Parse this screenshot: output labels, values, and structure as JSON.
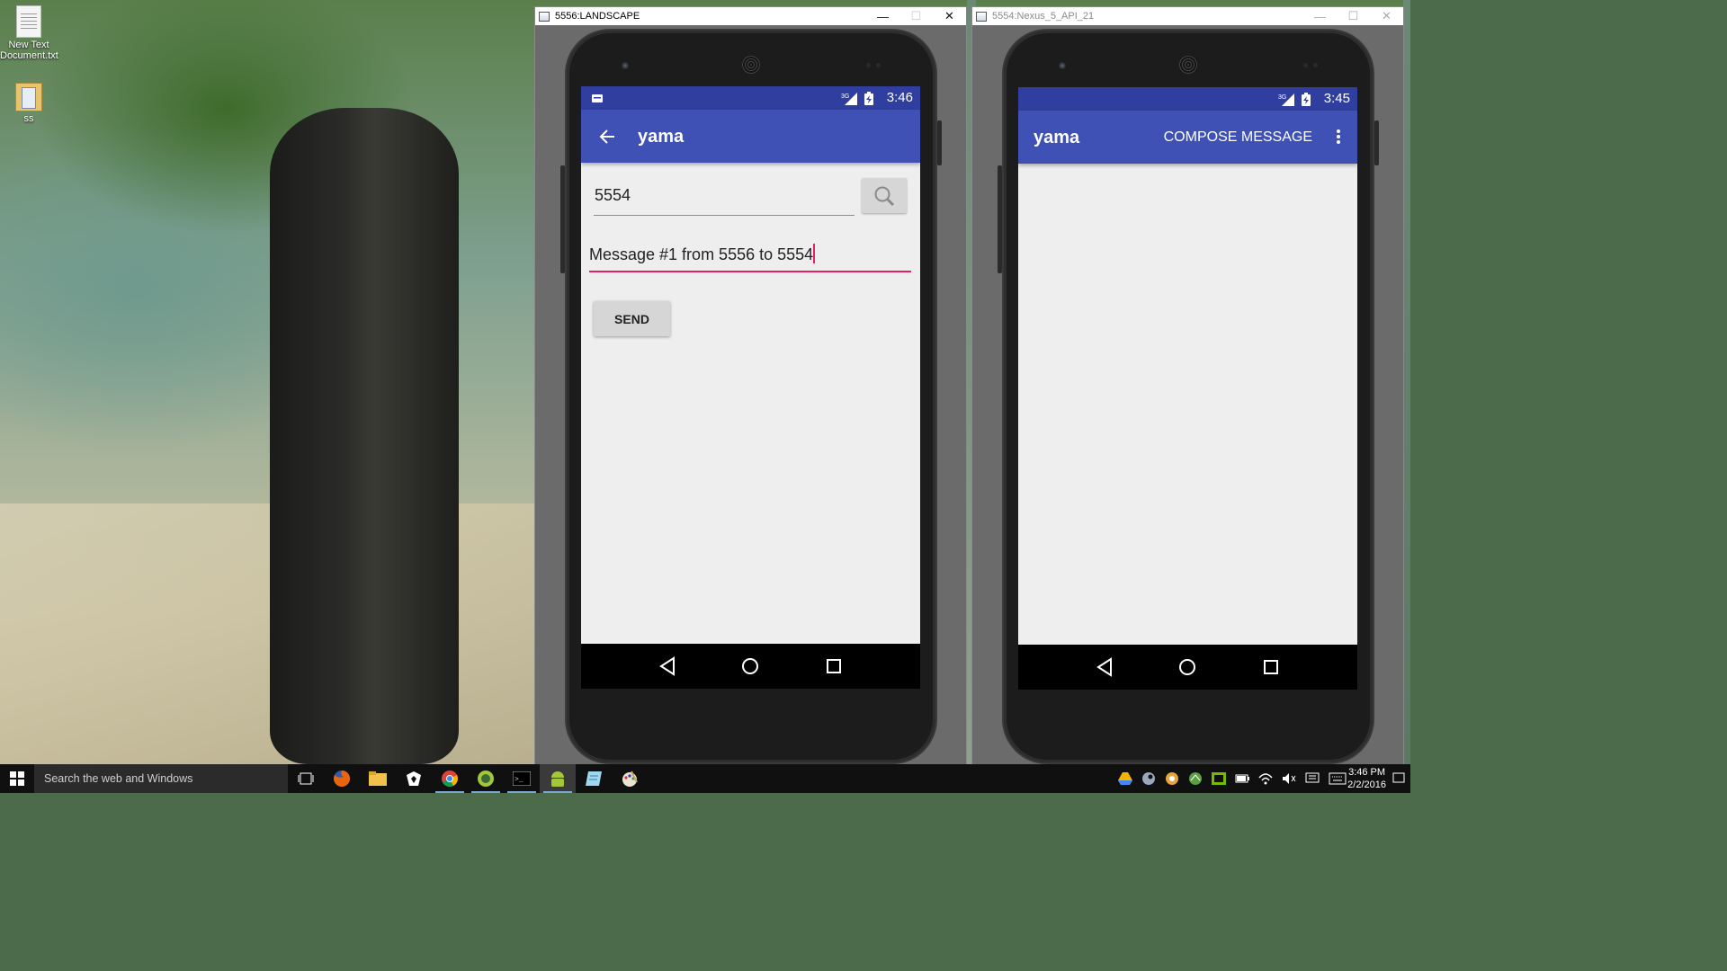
{
  "desktop": {
    "icons": [
      {
        "label": "New Text Document.txt"
      },
      {
        "label": "ss"
      }
    ]
  },
  "window_left": {
    "title": "5556:LANDSCAPE",
    "status_time": "3:46",
    "network": "3G",
    "app_title": "yama",
    "number_field_value": "5554",
    "message_field_value": "Message #1 from 5556 to 5554",
    "send_label": "SEND"
  },
  "window_right": {
    "title": "5554:Nexus_5_API_21",
    "status_time": "3:45",
    "network": "3G",
    "app_title": "yama",
    "action_label": "COMPOSE MESSAGE"
  },
  "taskbar": {
    "search_placeholder": "Search the web and Windows",
    "clock_time": "3:46 PM",
    "clock_date": "2/2/2016",
    "apps": [
      "task-view",
      "firefox",
      "file-explorer",
      "app",
      "chrome",
      "android-studio",
      "command-prompt",
      "android",
      "notepad",
      "paint"
    ]
  },
  "colors": {
    "status_bar": "#303f9f",
    "toolbar": "#3f51b5",
    "accent": "#e91e63",
    "screen_bg": "#eeeeee"
  }
}
